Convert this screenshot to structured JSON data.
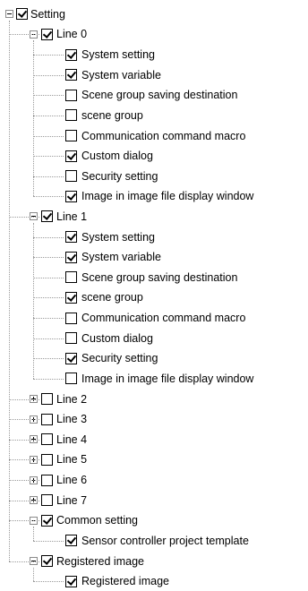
{
  "tree": {
    "label": "Setting",
    "checked": true,
    "expanded": true,
    "children": [
      {
        "label": "Line 0",
        "checked": true,
        "expanded": true,
        "children": [
          {
            "label": "System setting",
            "checked": true
          },
          {
            "label": "System variable",
            "checked": true
          },
          {
            "label": "Scene group saving destination",
            "checked": false
          },
          {
            "label": "scene group",
            "checked": false
          },
          {
            "label": "Communication command macro",
            "checked": false
          },
          {
            "label": "Custom dialog",
            "checked": true
          },
          {
            "label": "Security setting",
            "checked": false
          },
          {
            "label": "Image in image file display window",
            "checked": true
          }
        ]
      },
      {
        "label": "Line 1",
        "checked": true,
        "expanded": true,
        "children": [
          {
            "label": "System setting",
            "checked": true
          },
          {
            "label": "System variable",
            "checked": true
          },
          {
            "label": "Scene group saving destination",
            "checked": false
          },
          {
            "label": "scene group",
            "checked": true
          },
          {
            "label": "Communication command macro",
            "checked": false
          },
          {
            "label": "Custom dialog",
            "checked": false
          },
          {
            "label": "Security setting",
            "checked": true
          },
          {
            "label": "Image in image file display window",
            "checked": false
          }
        ]
      },
      {
        "label": "Line 2",
        "checked": false,
        "expanded": false,
        "children": []
      },
      {
        "label": "Line 3",
        "checked": false,
        "expanded": false,
        "children": []
      },
      {
        "label": "Line 4",
        "checked": false,
        "expanded": false,
        "children": []
      },
      {
        "label": "Line 5",
        "checked": false,
        "expanded": false,
        "children": []
      },
      {
        "label": "Line 6",
        "checked": false,
        "expanded": false,
        "children": []
      },
      {
        "label": "Line 7",
        "checked": false,
        "expanded": false,
        "children": []
      },
      {
        "label": "Common setting",
        "checked": true,
        "expanded": true,
        "children": [
          {
            "label": "Sensor controller project template",
            "checked": true
          }
        ]
      },
      {
        "label": "Registered image",
        "checked": true,
        "expanded": true,
        "children": [
          {
            "label": "Registered image",
            "checked": true
          }
        ]
      }
    ]
  }
}
